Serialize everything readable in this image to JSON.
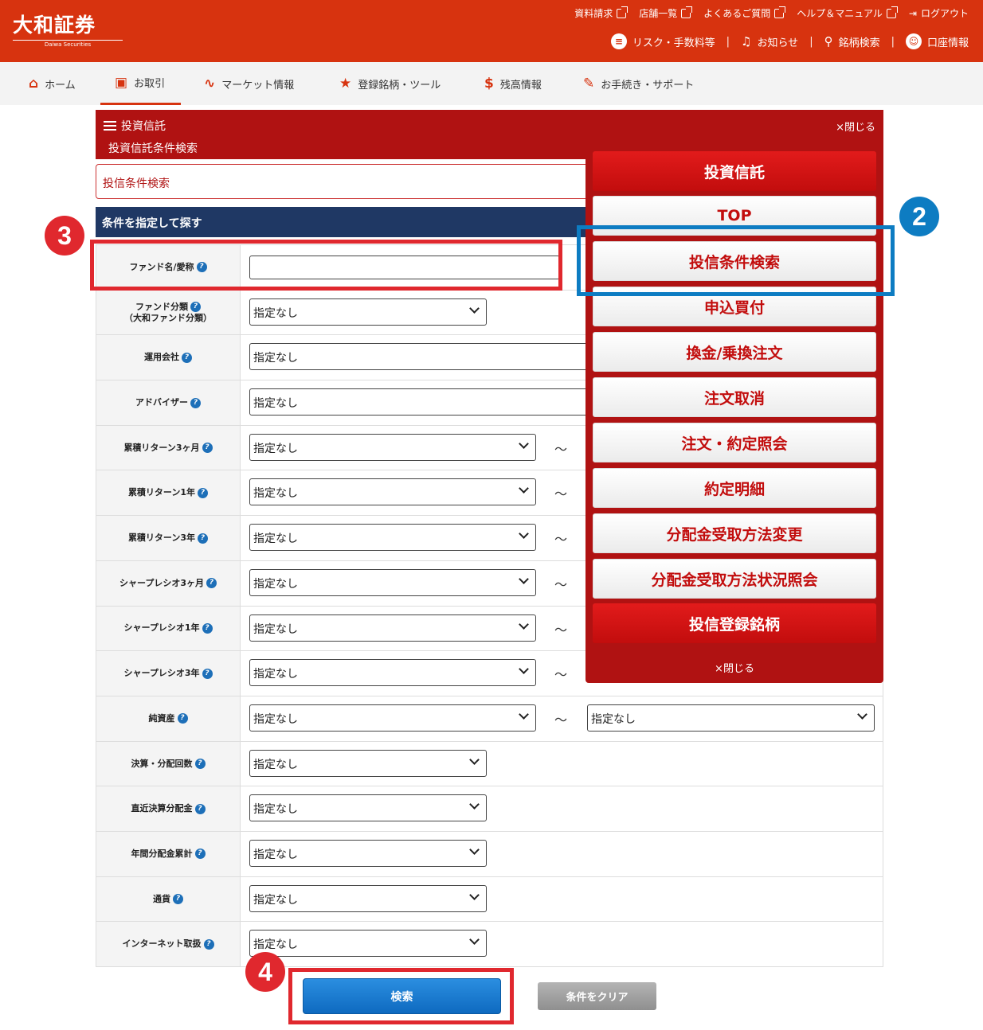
{
  "header": {
    "logo_main": "大和証券",
    "logo_sub": "Daiwa Securities",
    "top_links": [
      "資料請求",
      "店舗一覧",
      "よくあるご質問",
      "ヘルプ＆マニュアル"
    ],
    "logout": "ログアウト",
    "second_links": [
      "リスク・手数料等",
      "お知らせ",
      "銘柄検索",
      "口座情報"
    ]
  },
  "gnav": [
    "ホーム",
    "お取引",
    "マーケット情報",
    "登録銘柄・ツール",
    "残高情報",
    "お手続き・サポート"
  ],
  "panel": {
    "title": "投資信託",
    "subtitle": "投資信託条件検索",
    "close": "×閉じる"
  },
  "search_title": "投信条件検索",
  "section_title": "条件を指定して探す",
  "form": {
    "default_option": "指定なし",
    "tilde": "〜",
    "rows": [
      {
        "label": "ファンド名/愛称"
      },
      {
        "label": "ファンド分類",
        "label2": "（大和ファンド分類）"
      },
      {
        "label": "運用会社"
      },
      {
        "label": "アドバイザー"
      },
      {
        "label": "累積リターン3ヶ月"
      },
      {
        "label": "累積リターン1年"
      },
      {
        "label": "累積リターン3年"
      },
      {
        "label": "シャープレシオ3ヶ月"
      },
      {
        "label": "シャープレシオ1年"
      },
      {
        "label": "シャープレシオ3年"
      },
      {
        "label": "純資産"
      },
      {
        "label": "決算・分配回数"
      },
      {
        "label": "直近決算分配金"
      },
      {
        "label": "年間分配金累計"
      },
      {
        "label": "通貨"
      },
      {
        "label": "インターネット取扱"
      }
    ]
  },
  "buttons": {
    "search": "検索",
    "clear": "条件をクリア"
  },
  "side_menu": {
    "title": "投資信託",
    "items": [
      "TOP",
      "投信条件検索",
      "申込買付",
      "換金/乗換注文",
      "注文取消",
      "注文・約定照会",
      "約定明細",
      "分配金受取方法変更",
      "分配金受取方法状況照会"
    ],
    "footer": "投信登録銘柄",
    "close": "×閉じる"
  },
  "annotations": {
    "b2": "2",
    "b3": "3",
    "b4": "4"
  },
  "colors": {
    "brand": "#d7330f",
    "panel": "#b01212",
    "navy": "#1f3864",
    "callout_red": "#e0282e",
    "callout_blue": "#0d7cc2"
  }
}
